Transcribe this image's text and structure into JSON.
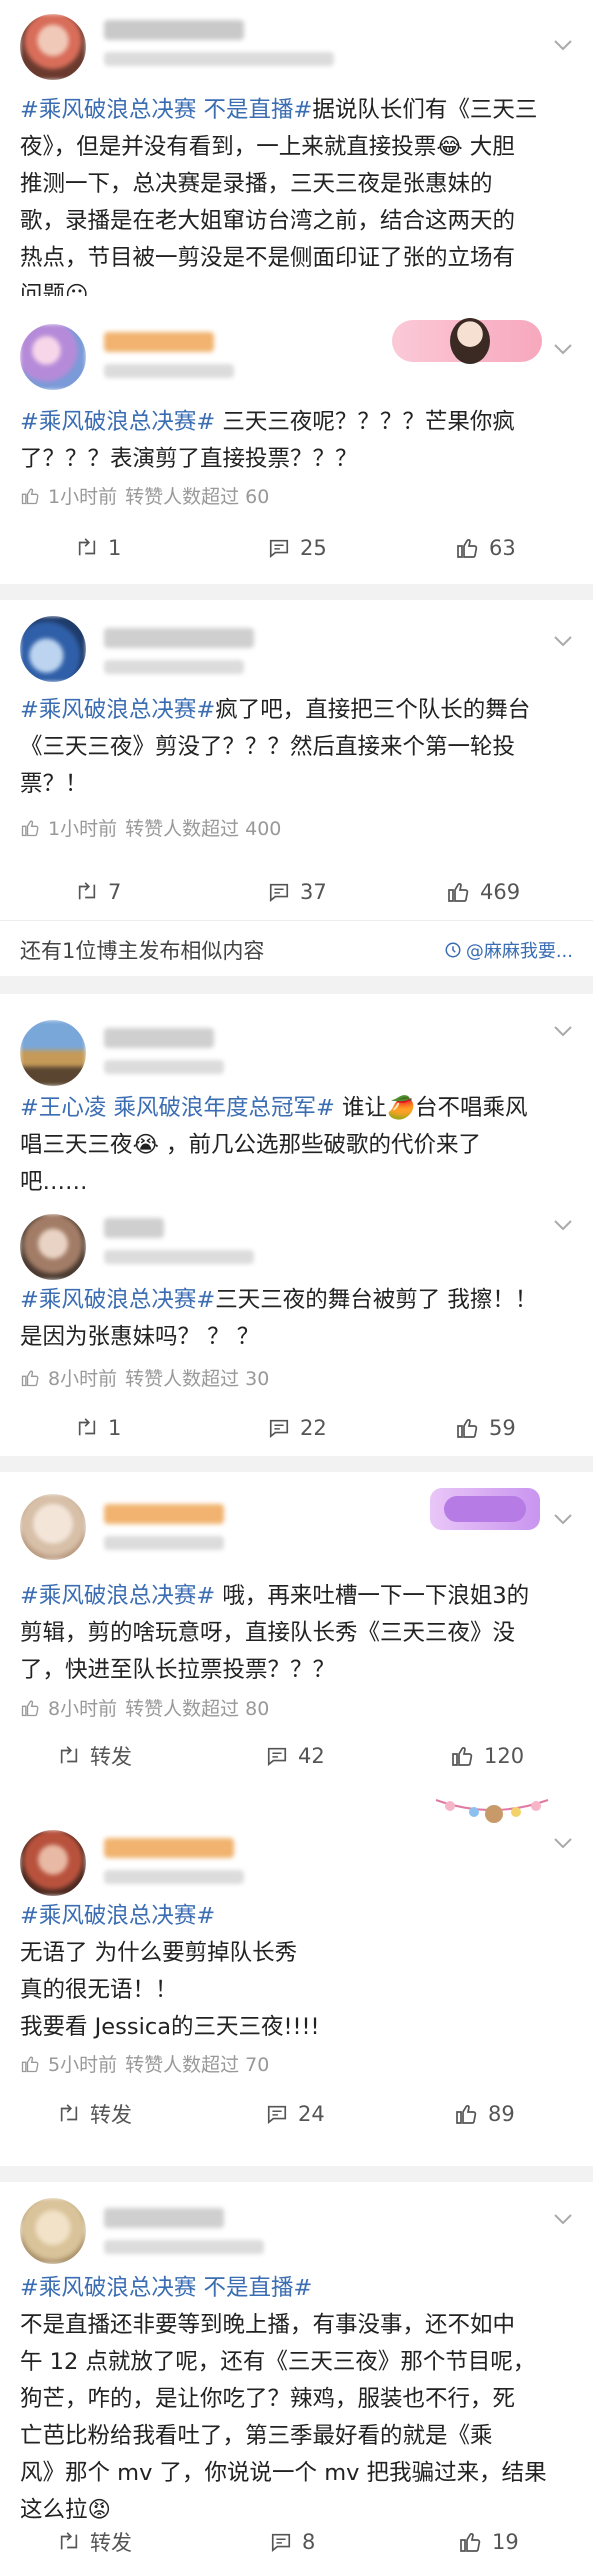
{
  "posts": [
    {
      "text_lines": [
        [
          {
            "t": "#乘风破浪总决赛 不是直播#",
            "tag": true
          },
          {
            "t": "据说队长们有《三天三"
          }
        ],
        [
          {
            "t": "夜》，但是并没有看到，一上来就直接投票😂 大胆"
          }
        ],
        [
          {
            "t": "推测一下，总决赛是录播，三天三夜是张惠妹的"
          }
        ],
        [
          {
            "t": "歌，录播是在老大姐窜访台湾之前，结合这两天的"
          }
        ],
        [
          {
            "t": "热点，节目被一剪没是不是侧面印证了张的立场有"
          }
        ],
        [
          {
            "t": "问题😶"
          }
        ]
      ]
    },
    {
      "text_lines": [
        [
          {
            "t": "#乘风破浪总决赛#",
            "tag": true
          },
          {
            "t": "  三天三夜呢？？？？芒果你疯"
          }
        ],
        [
          {
            "t": "了？？？表演剪了直接投票？？？"
          }
        ]
      ],
      "time": "1小时前",
      "reposts": "转赞人数超过 60",
      "actions": {
        "repost": "1",
        "comment": "25",
        "like": "63"
      }
    },
    {
      "text_lines": [
        [
          {
            "t": "#乘风破浪总决赛#",
            "tag": true
          },
          {
            "t": "疯了吧，直接把三个队长的舞台"
          }
        ],
        [
          {
            "t": "《三天三夜》剪没了？？？然后直接来个第一轮投"
          }
        ],
        [
          {
            "t": "票？！"
          }
        ]
      ],
      "time": "1小时前",
      "reposts": "转赞人数超过 400",
      "actions": {
        "repost": "7",
        "comment": "37",
        "like": "469"
      }
    },
    {
      "text_lines": [
        [
          {
            "t": "#王心凌 乘风破浪年度总冠军#",
            "tag": true
          },
          {
            "t": " 谁让🥭台不唱乘风"
          }
        ],
        [
          {
            "t": "唱三天三夜😭 ，前几公选那些破歌的代价来了"
          }
        ],
        [
          {
            "t": "吧……"
          }
        ]
      ]
    },
    {
      "text_lines": [
        [
          {
            "t": "#乘风破浪总决赛#",
            "tag": true
          },
          {
            "t": "三天三夜的舞台被剪了 我擦！！"
          }
        ],
        [
          {
            "t": "是因为张惠妹吗？ ？ ？"
          }
        ]
      ],
      "time": "8小时前",
      "reposts": "转赞人数超过 30",
      "actions": {
        "repost": "1",
        "comment": "22",
        "like": "59"
      }
    },
    {
      "text_lines": [
        [
          {
            "t": "#乘风破浪总决赛#",
            "tag": true
          },
          {
            "t": " 哦，再来吐槽一下一下浪姐3的"
          }
        ],
        [
          {
            "t": "剪辑，剪的啥玩意呀，直接队长秀《三天三夜》没"
          }
        ],
        [
          {
            "t": "了，快进至队长拉票投票？？？"
          }
        ]
      ],
      "time": "8小时前",
      "reposts": "转赞人数超过 80",
      "actions": {
        "repost": "转发",
        "comment": "42",
        "like": "120"
      }
    },
    {
      "text_lines": [
        [
          {
            "t": "#乘风破浪总决赛#",
            "tag": true
          }
        ],
        [
          {
            "t": "无语了 为什么要剪掉队长秀"
          }
        ],
        [
          {
            "t": "真的很无语！！"
          }
        ],
        [
          {
            "t": "我要看 Jessica的三天三夜!!!!"
          }
        ]
      ],
      "time": "5小时前",
      "reposts": "转赞人数超过 70",
      "actions": {
        "repost": "转发",
        "comment": "24",
        "like": "89"
      }
    },
    {
      "text_lines": [
        [
          {
            "t": "#乘风破浪总决赛 不是直播#",
            "tag": true
          }
        ],
        [
          {
            "t": "不是直播还非要等到晚上播，有事没事，还不如中"
          }
        ],
        [
          {
            "t": "午 12 点就放了呢，还有《三天三夜》那个节目呢，"
          }
        ],
        [
          {
            "t": "狗芒，咋的，是让你吃了？辣鸡，服装也不行，死"
          }
        ],
        [
          {
            "t": "亡芭比粉给我看吐了，第三季最好看的就是《乘"
          }
        ],
        [
          {
            "t": "风》那个 mv 了，你说说一个 mv 把我骗过来，结果"
          }
        ],
        [
          {
            "t": "这么拉😡"
          }
        ]
      ],
      "actions": {
        "repost": "转发",
        "comment": "8",
        "like": "19"
      }
    }
  ],
  "more_bar": {
    "text": "还有1位博主发布相似内容",
    "source": "@麻麻我要..."
  },
  "colors": {
    "hashtag": "#3b6db3",
    "username": "#e88a2c",
    "separator": "#f2f2f2"
  },
  "icons": {
    "repost": "repost-icon",
    "comment": "comment-icon",
    "like": "thumb-up-icon",
    "chevron": "chevron-down-icon"
  }
}
